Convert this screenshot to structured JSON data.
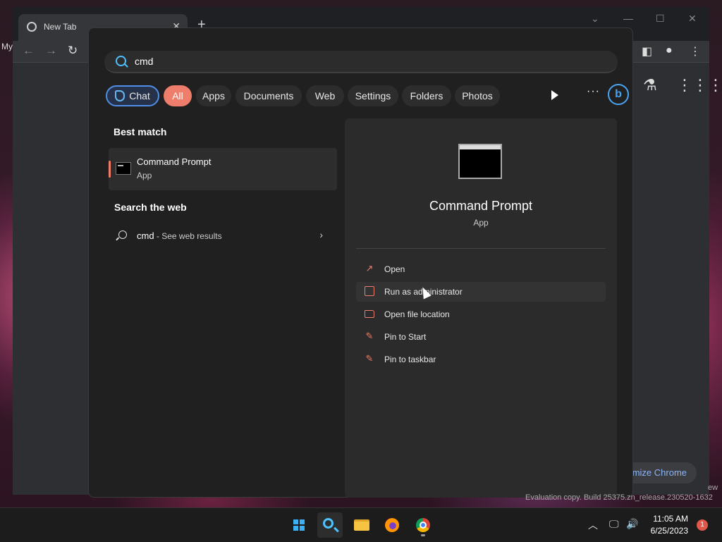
{
  "desktop": {
    "label_partial": "My",
    "watermark": "Evaluation copy. Build 25375.zn_release.230520-1632",
    "watermark_tail": "ew"
  },
  "chrome": {
    "tab_title": "New Tab",
    "tab_close": "✕",
    "new_tab": "+",
    "customize_label": "mize Chrome"
  },
  "search": {
    "query": "cmd",
    "filters": [
      "Chat",
      "All",
      "Apps",
      "Documents",
      "Web",
      "Settings",
      "Folders",
      "Photos"
    ],
    "active_filter": "All",
    "more": "···",
    "bing": "b"
  },
  "results": {
    "best_match_heading": "Best match",
    "best_match": {
      "name": "Command Prompt",
      "type": "App"
    },
    "web_heading": "Search the web",
    "web": {
      "query": "cmd",
      "suffix": " - See web results"
    }
  },
  "detail": {
    "name": "Command Prompt",
    "type": "App",
    "actions": [
      "Open",
      "Run as administrator",
      "Open file location",
      "Pin to Start",
      "Pin to taskbar"
    ],
    "hovered_action": "Run as administrator"
  },
  "taskbar": {
    "time": "11:05 AM",
    "date": "6/25/2023",
    "notifications": "1"
  },
  "colors": {
    "accent": "#ef7d6b",
    "chat_border": "#4f8de6",
    "search_blue": "#4cc2ff"
  }
}
